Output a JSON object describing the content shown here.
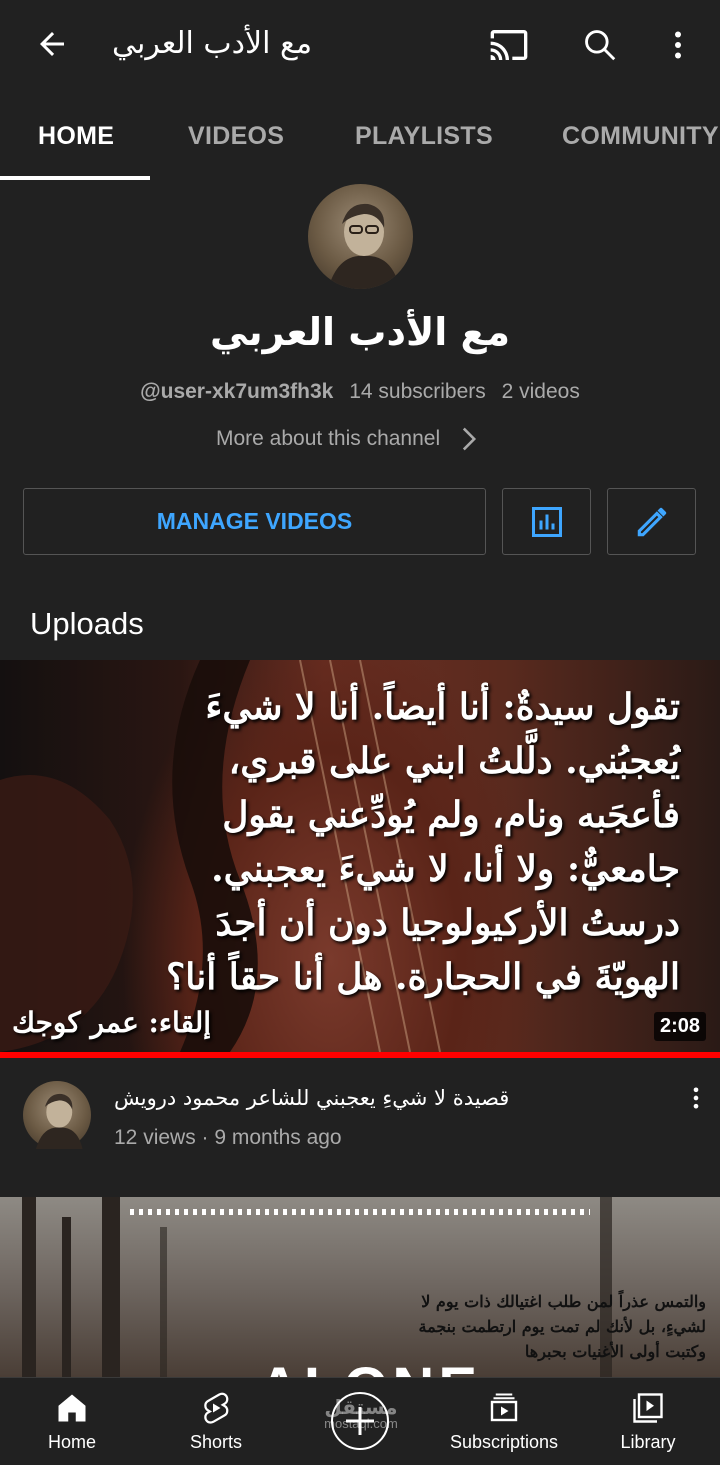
{
  "topbar": {
    "title": "مع الأدب العربي",
    "icons": [
      "back-arrow-icon",
      "cast-icon",
      "search-icon",
      "more-vert-icon"
    ]
  },
  "tabs": [
    {
      "label": "HOME",
      "active": true
    },
    {
      "label": "VIDEOS",
      "active": false
    },
    {
      "label": "PLAYLISTS",
      "active": false
    },
    {
      "label": "COMMUNITY",
      "active": false
    }
  ],
  "channel": {
    "name": "مع الأدب العربي",
    "handle": "@user-xk7um3fh3k",
    "subscribers": "14 subscribers",
    "videos": "2 videos",
    "more_about": "More about this channel"
  },
  "actions": {
    "manage_videos": "MANAGE VIDEOS",
    "analytics_icon": "analytics-icon",
    "edit_icon": "edit-pencil-icon"
  },
  "uploads": {
    "section_title": "Uploads",
    "videos": [
      {
        "title": "قصيدة لا شيءِ يعجبني للشاعر محمود درويش",
        "meta": "12 views · 9 months ago",
        "duration": "2:08",
        "thumbnail_text": "تقول سيدةٌ: أنا أيضاً. أنا لا شيءَ يُعجبُني. دلَّلتُ ابني على قبري، فأعجَبه ونام، ولم يُودِّعني يقول جامعيٌّ: ولا أنا، لا شيءَ يعجبني. درستُ الأركيولوجيا دون أن أجدَ الهويّةَ في الحجارة. هل أنا حقاً أنا؟",
        "thumbnail_credit": "إلقاء: عمر كوجك"
      },
      {
        "title": "",
        "thumbnail_text": "والتمس عذراً لمن طلب اغتيالك ذات يوم لا لشيءٍ، بل لأنك لم تمت يوم ارتطمت بنجمة وكتبت أولى الأغنيات بحبرها",
        "thumbnail_word": "ALONE"
      }
    ]
  },
  "bottom_nav": [
    {
      "label": "Home",
      "icon": "home-icon"
    },
    {
      "label": "Shorts",
      "icon": "shorts-icon"
    },
    {
      "label": "",
      "icon": "create-plus-icon"
    },
    {
      "label": "Subscriptions",
      "icon": "subscriptions-icon"
    },
    {
      "label": "Library",
      "icon": "library-icon"
    }
  ],
  "watermark": {
    "arabic": "مستقل",
    "latin": "mostaql.com"
  },
  "colors": {
    "background": "#212121",
    "accent_blue": "#3ea6ff",
    "progress_red": "#ff0000",
    "secondary_text": "#aaaaaa"
  }
}
